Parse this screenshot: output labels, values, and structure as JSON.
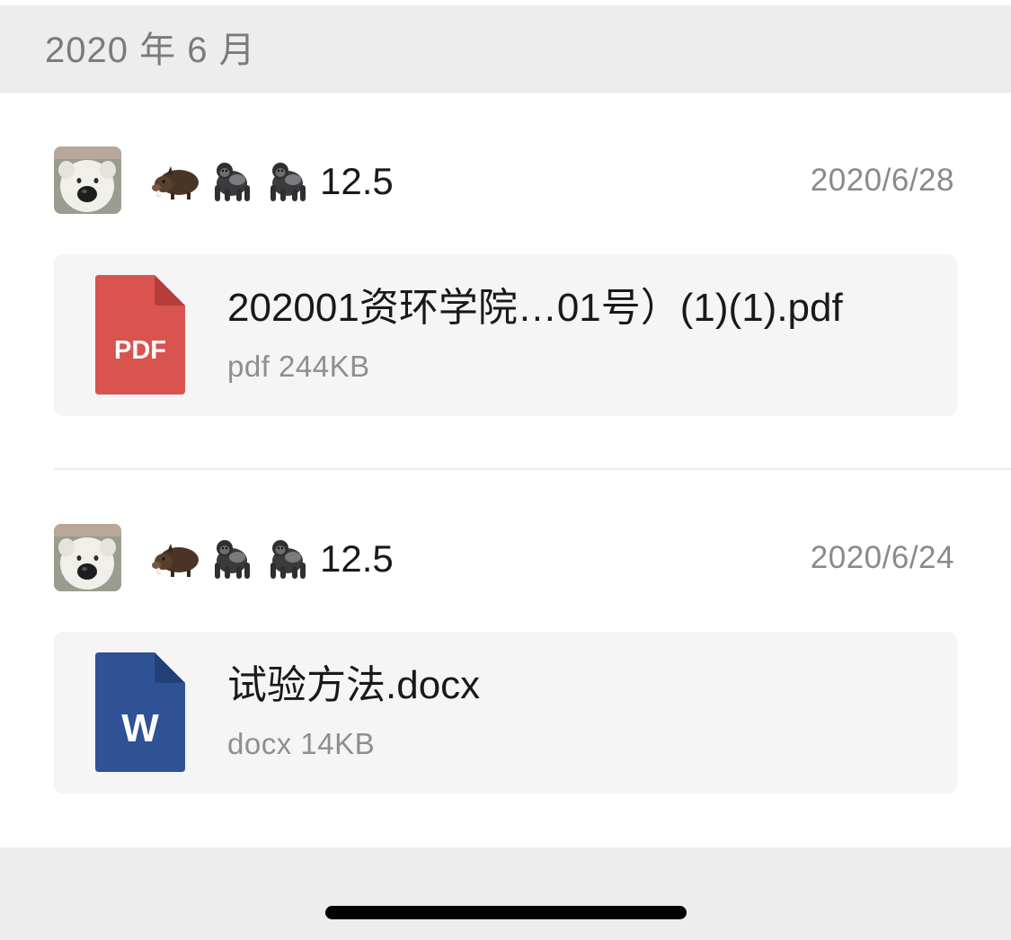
{
  "month_header": {
    "label": "2020 年 6 月"
  },
  "entries": [
    {
      "sender_name": "12.5",
      "sender_emoji_icons": [
        "boar-icon",
        "gorilla-icon",
        "gorilla-icon"
      ],
      "date": "2020/6/28",
      "file": {
        "name": "202001资环学院…01号）(1)(1).pdf",
        "meta": "pdf 244KB",
        "icon": "pdf-file-icon",
        "icon_label": "PDF",
        "icon_color": "#d9534f"
      }
    },
    {
      "sender_name": "12.5",
      "sender_emoji_icons": [
        "boar-icon",
        "gorilla-icon",
        "gorilla-icon"
      ],
      "date": "2020/6/24",
      "file": {
        "name": "试验方法.docx",
        "meta": "docx 14KB",
        "icon": "word-file-icon",
        "icon_label": "W",
        "icon_color": "#2f5297"
      }
    }
  ]
}
